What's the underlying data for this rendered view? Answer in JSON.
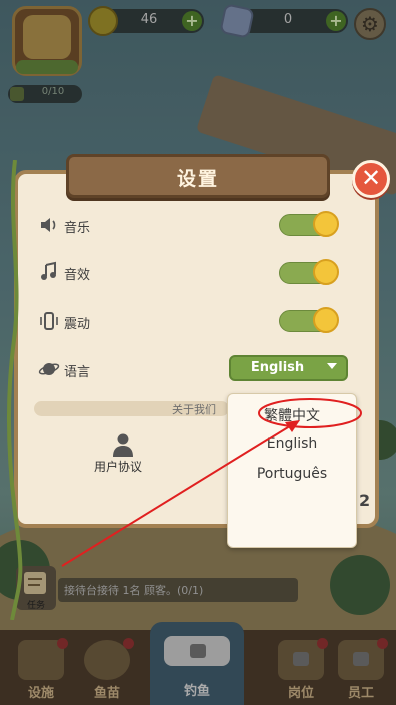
{
  "hud": {
    "coins": "46",
    "gems": "0",
    "energy": "0/10"
  },
  "dialog": {
    "title": "设置",
    "settings": [
      {
        "icon": "speaker-icon",
        "label": "音乐",
        "on": true
      },
      {
        "icon": "music-note-icon",
        "label": "音效",
        "on": true
      },
      {
        "icon": "vibration-icon",
        "label": "震动",
        "on": true
      }
    ],
    "language_label": "语言",
    "language_value": "English",
    "about_label": "关于我们",
    "agreement_label": "用户协议",
    "side_number": "2"
  },
  "language_options": [
    "繁體中文",
    "English",
    "Português"
  ],
  "task": {
    "label": "任务",
    "text": "接待台接待 1名 顾客。(0/1)"
  },
  "bottom_nav": [
    {
      "label": "设施"
    },
    {
      "label": "鱼苗"
    },
    {
      "label": "钓鱼"
    },
    {
      "label": "岗位"
    },
    {
      "label": "员工"
    }
  ],
  "colors": {
    "toggle_on": "#8aaa50",
    "toggle_knob": "#f3c53a",
    "close_button": "#e5573d",
    "dropdown_select": "#7aa345",
    "annotation": "#e02020"
  }
}
